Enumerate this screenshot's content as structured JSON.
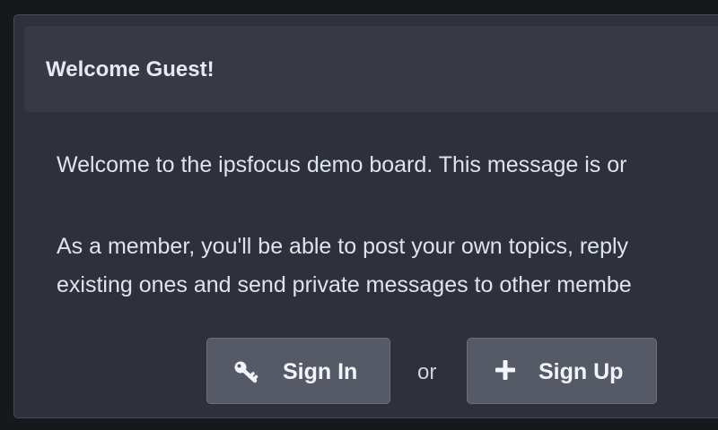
{
  "guest_panel": {
    "title": "Welcome Guest!",
    "message_line_1": "Welcome to the ipsfocus demo board. This message is or",
    "message_line_2": "As a member, you'll be able to post your own topics, reply",
    "message_line_3": "existing ones and send private messages to other membe",
    "sign_in": {
      "label": "Sign In",
      "icon": "key-icon"
    },
    "separator": "or",
    "sign_up": {
      "label": "Sign Up",
      "icon": "plus-icon"
    }
  },
  "colors": {
    "page_background": "#17181c",
    "panel_background": "#2e3139",
    "header_background": "#373a43",
    "button_background": "#555a66",
    "text": "#dde3ef"
  }
}
